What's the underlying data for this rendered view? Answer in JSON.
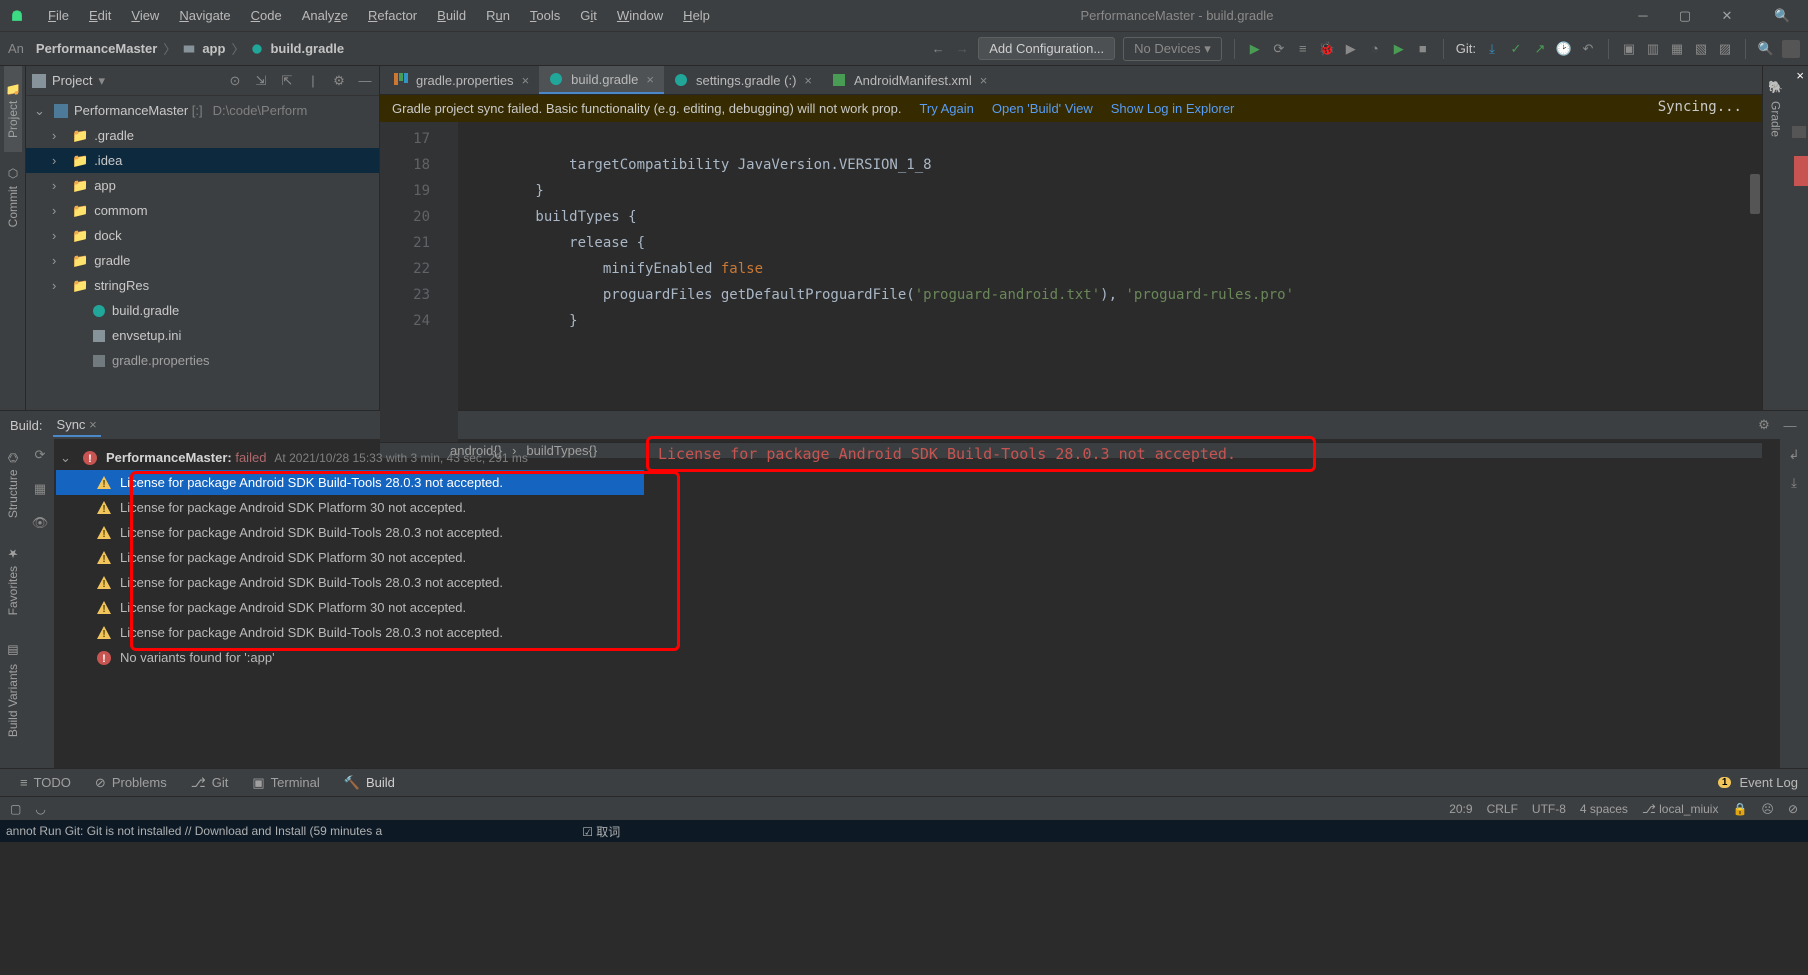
{
  "app": {
    "title": "PerformanceMaster - build.gradle"
  },
  "menu": [
    "File",
    "Edit",
    "View",
    "Navigate",
    "Code",
    "Analyze",
    "Refactor",
    "Build",
    "Run",
    "Tools",
    "Git",
    "Window",
    "Help"
  ],
  "breadcrumbs": {
    "root": "PerformanceMaster",
    "mid": "app",
    "leaf": "build.gradle"
  },
  "navbar": {
    "addConfig": "Add Configuration...",
    "noDevices": "No Devices ▾",
    "gitLabel": "Git:"
  },
  "projectPanel": {
    "title": "Project",
    "root": {
      "name": "PerformanceMaster",
      "hint": "D:\\code\\Perform"
    },
    "folders": [
      ".gradle",
      ".idea",
      "app",
      "commom",
      "dock",
      "gradle",
      "stringRes"
    ],
    "files": [
      "build.gradle",
      "envsetup.ini",
      "gradle.properties"
    ]
  },
  "tabs": [
    {
      "label": "gradle.properties",
      "active": false
    },
    {
      "label": "build.gradle",
      "active": true
    },
    {
      "label": "settings.gradle (:)",
      "active": false
    },
    {
      "label": "AndroidManifest.xml",
      "active": false
    }
  ],
  "banner": {
    "msg": "Gradle project sync failed. Basic functionality (e.g. editing, debugging) will not work prop.",
    "links": [
      "Try Again",
      "Open 'Build' View",
      "Show Log in Explorer"
    ],
    "sync": "Syncing..."
  },
  "code": {
    "lines": [
      {
        "n": "17",
        "t": "            targetCompatibility JavaVersion.VERSION_1_8"
      },
      {
        "n": "18",
        "t": "        }"
      },
      {
        "n": "19",
        "t": "        buildTypes {"
      },
      {
        "n": "20",
        "t": "            release {"
      },
      {
        "n": "21",
        "t": "                minifyEnabled "
      },
      {
        "n": "22",
        "t": "                proguardFiles getDefaultProguardFile("
      },
      {
        "n": "23",
        "t": "            }"
      },
      {
        "n": "24",
        "t": ""
      }
    ],
    "kw_false": "false",
    "str1": "'proguard-android.txt'",
    "mid": "), ",
    "str2": "'proguard-rules.pro'",
    "crumbs": [
      "android{}",
      "buildTypes{}"
    ]
  },
  "leftStrip": [
    "Project",
    "Commit",
    "Structure",
    "Favorites",
    "Build Variants"
  ],
  "rightStrip": [
    "Gradle"
  ],
  "build": {
    "headLabel": "Build:",
    "syncTab": "Sync",
    "root": {
      "name": "PerformanceMaster:",
      "status": "failed",
      "time": "At 2021/10/28 15:33 with 3 min, 43 sec, 291 ms"
    },
    "warnings": [
      "License for package Android SDK Build-Tools 28.0.3 not accepted.",
      "License for package Android SDK Platform 30 not accepted.",
      "License for package Android SDK Build-Tools 28.0.3 not accepted.",
      "License for package Android SDK Platform 30 not accepted.",
      "License for package Android SDK Build-Tools 28.0.3 not accepted.",
      "License for package Android SDK Platform 30 not accepted.",
      "License for package Android SDK Build-Tools 28.0.3 not accepted."
    ],
    "error": "No variants found for ':app'",
    "detail": "License for package Android SDK Build-Tools 28.0.3 not accepted."
  },
  "bottomTabs": [
    "TODO",
    "Problems",
    "Git",
    "Terminal",
    "Build"
  ],
  "eventLog": {
    "count": "1",
    "label": "Event Log"
  },
  "status": {
    "pos": "20:9",
    "eol": "CRLF",
    "enc": "UTF-8",
    "indent": "4 spaces",
    "branch": "local_miuix"
  },
  "taskbar": "annot Run Git: Git is not installed // Download and Install (59 minutes a",
  "taskbar2": "取词"
}
